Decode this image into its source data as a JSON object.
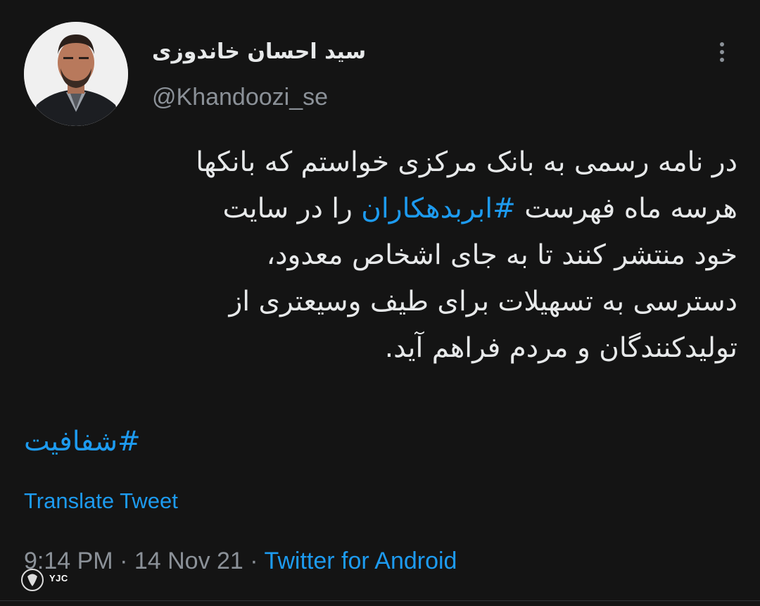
{
  "author": {
    "display_name": "سید احسان خاندوزی",
    "handle": "@Khandoozi_se"
  },
  "icons": {
    "more": "more-vertical-icon",
    "avatar": "profile-photo"
  },
  "tweet": {
    "lines": [
      "در نامه رسمی به بانک مرکزی خواستم که بانکها",
      "را در سایت",
      "هرسه ماه فهرست",
      "خود منتشر کنند تا به جای اشخاص معدود،",
      "دسترسی به تسهیلات برای طیف وسیعتری از",
      "تولیدکنندگان و مردم فراهم آید."
    ],
    "inline_hashtag": "#ابربدهکاران",
    "hashtag": "#شفافیت"
  },
  "translate_label": "Translate Tweet",
  "meta": {
    "time": "9:14 PM",
    "separator": " · ",
    "date": "14 Nov 21",
    "source": "Twitter for Android"
  },
  "watermark": {
    "text": "YJC"
  },
  "colors": {
    "background": "#141414",
    "text": "#e7e9ea",
    "muted": "#8b9198",
    "link": "#1d9bf0"
  }
}
